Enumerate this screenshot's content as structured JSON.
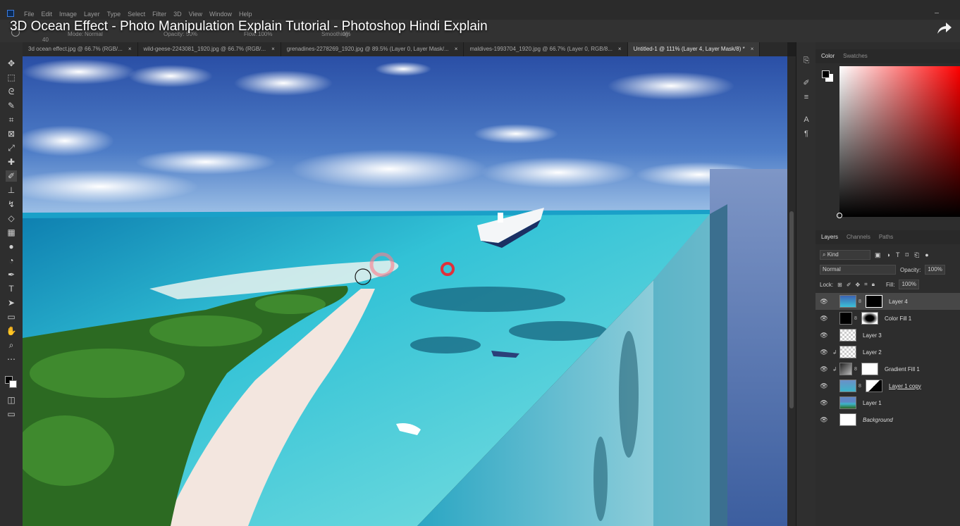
{
  "video_title": "3D Ocean Effect - Photo Manipulation Explain Tutorial - Photoshop Hindi Explain",
  "menu": [
    "File",
    "Edit",
    "Image",
    "Layer",
    "Type",
    "Select",
    "Filter",
    "3D",
    "View",
    "Window",
    "Help"
  ],
  "options_bar": {
    "brush_size": "40",
    "mode_label": "Mode:",
    "mode_value": "Normal",
    "opacity_label": "Opacity:",
    "opacity_value": "50%",
    "flow_label": "Flow:",
    "flow_value": "100%",
    "smoothing_label": "Smoothing:",
    "smoothing_value": "0%"
  },
  "tabs": [
    {
      "label": "3d ocean effect.jpg @ 66.7% (RGB/...",
      "active": false
    },
    {
      "label": "wild-geese-2243081_1920.jpg @ 66.7% (RGB/...",
      "active": false
    },
    {
      "label": "grenadines-2278269_1920.jpg @ 89.5% (Layer 0, Layer Mask/...",
      "active": false
    },
    {
      "label": "maldives-1993704_1920.jpg @ 66.7% (Layer 0, RGB/8...",
      "active": false
    },
    {
      "label": "Untitled-1 @ 111% (Layer 4, Layer Mask/8) *",
      "active": true
    }
  ],
  "tab_close": "×",
  "color_panel": {
    "tabs": [
      "Color",
      "Swatches"
    ],
    "active": "Color",
    "hue_color": "#ff0000"
  },
  "layers_panel": {
    "tabs": [
      "Layers",
      "Channels",
      "Paths"
    ],
    "active": "Layers",
    "filter_kind": "Kind",
    "blend_mode": "Normal",
    "opacity_label": "Opacity:",
    "opacity_value": "100%",
    "lock_label": "Lock:",
    "fill_label": "Fill:",
    "fill_value": "100%",
    "layers": [
      {
        "name": "Layer 4",
        "selected": true,
        "clipped": false,
        "has_mask": true,
        "italic": false
      },
      {
        "name": "Color Fill 1",
        "selected": false,
        "clipped": false,
        "has_mask": true,
        "italic": false
      },
      {
        "name": "Layer 3",
        "selected": false,
        "clipped": false,
        "has_mask": false,
        "italic": false
      },
      {
        "name": "Layer 2",
        "selected": false,
        "clipped": true,
        "has_mask": false,
        "italic": false
      },
      {
        "name": "Gradient Fill 1",
        "selected": false,
        "clipped": true,
        "has_mask": true,
        "italic": false
      },
      {
        "name": "Layer 1 copy",
        "selected": false,
        "clipped": false,
        "has_mask": true,
        "italic": false
      },
      {
        "name": "Layer 1",
        "selected": false,
        "clipped": false,
        "has_mask": false,
        "italic": false
      },
      {
        "name": "Background",
        "selected": false,
        "clipped": false,
        "has_mask": false,
        "italic": true
      }
    ]
  },
  "tools": [
    "move-tool",
    "marquee-tool",
    "lasso-tool",
    "quick-select-tool",
    "crop-tool",
    "frame-tool",
    "eyedropper-tool",
    "healing-tool",
    "brush-tool",
    "stamp-tool",
    "history-brush-tool",
    "eraser-tool",
    "gradient-tool",
    "blur-tool",
    "dodge-tool",
    "pen-tool",
    "type-tool",
    "path-select-tool",
    "rectangle-tool",
    "hand-tool",
    "zoom-tool",
    "more-tools"
  ],
  "colors": {
    "accent_ring": "#e0303a",
    "panel_bg": "#2d2d2d",
    "selected_layer": "#474747"
  }
}
